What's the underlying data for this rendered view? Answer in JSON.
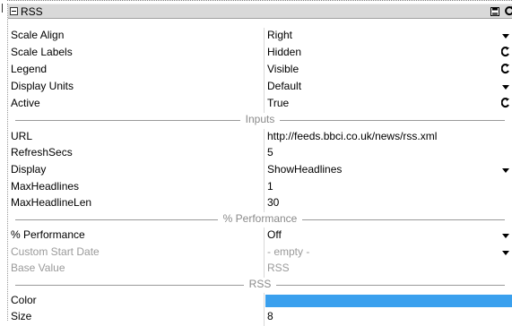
{
  "panel": {
    "title": "RSS"
  },
  "rows": {
    "scale_align": {
      "label": "Scale Align",
      "value": "Right"
    },
    "scale_labels": {
      "label": "Scale Labels",
      "value": "Hidden"
    },
    "legend": {
      "label": "Legend",
      "value": "Visible"
    },
    "display_units": {
      "label": "Display Units",
      "value": "Default"
    },
    "active": {
      "label": "Active",
      "value": "True"
    },
    "url": {
      "label": "URL",
      "value": "http://feeds.bbci.co.uk/news/rss.xml"
    },
    "refresh_secs": {
      "label": "RefreshSecs",
      "value": "5"
    },
    "display": {
      "label": "Display",
      "value": "ShowHeadlines"
    },
    "max_headlines": {
      "label": "MaxHeadlines",
      "value": "1"
    },
    "max_headline_len": {
      "label": "MaxHeadlineLen",
      "value": "30"
    },
    "performance": {
      "label": "% Performance",
      "value": "Off"
    },
    "custom_start_date": {
      "label": "Custom Start Date",
      "value": "- empty -"
    },
    "base_value": {
      "label": "Base Value",
      "value": "RSS"
    },
    "color": {
      "label": "Color",
      "value": "#3aa0ee"
    },
    "size": {
      "label": "Size",
      "value": "8"
    }
  },
  "sections": {
    "inputs": "Inputs",
    "performance": "% Performance",
    "rss": "RSS"
  },
  "icons": {
    "collapse": "collapse-box-icon",
    "save": "save-icon",
    "refresh": "refresh-icon",
    "dropdown": "dropdown-arrow-icon",
    "cycle": "cycle-icon"
  }
}
